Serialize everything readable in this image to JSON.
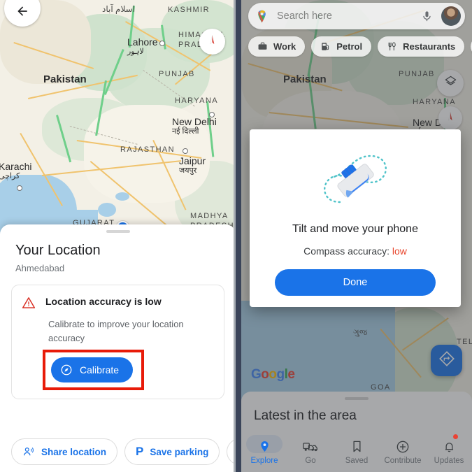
{
  "left_panel": {
    "back_icon": "arrow-back-icon",
    "compass_icon": "compass-icon",
    "map": {
      "country_labels": [
        "Pakistan"
      ],
      "region_labels": [
        "KASHMIR",
        "HIMACHAL PRADESH",
        "PUNJAB",
        "HARYANA",
        "RAJASTHAN",
        "GUJARAT",
        "MADHYA PRADESH"
      ],
      "cities": [
        {
          "name": "Lahore",
          "native": "لاہور"
        },
        {
          "name": "New Delhi",
          "native": "नई दिल्ली"
        },
        {
          "name": "Jaipur",
          "native": "जयपुर"
        },
        {
          "name": "Karachi",
          "native": "کراچی"
        },
        {
          "name": "اسلام آباد",
          "native": ""
        }
      ]
    },
    "sheet": {
      "title": "Your Location",
      "subtitle": "Ahmedabad",
      "accuracy_card": {
        "warning_icon": "warning-triangle-icon",
        "heading": "Location accuracy is low",
        "body": "Calibrate to improve your location accuracy",
        "calibrate_button": {
          "label": "Calibrate",
          "icon": "compass-circle-icon",
          "highlighted": true,
          "highlight_color": "#e81b09",
          "background": "#1a73e8"
        }
      },
      "chips": [
        {
          "label": "Share location",
          "icon": "share-person-icon"
        },
        {
          "label": "Save parking",
          "icon": "parking-p-icon"
        },
        {
          "label": "",
          "icon": "feedback-message-icon"
        }
      ]
    }
  },
  "right_panel": {
    "search": {
      "placeholder": "Search here",
      "logo_icon": "google-maps-pin-icon",
      "mic_icon": "microphone-icon",
      "avatar_icon": "account-avatar"
    },
    "category_chips": [
      {
        "label": "Work",
        "icon": "briefcase-icon"
      },
      {
        "label": "Petrol",
        "icon": "fuel-pump-icon"
      },
      {
        "label": "Restaurants",
        "icon": "cutlery-icon"
      },
      {
        "label": "",
        "icon": "hotel-bed-icon"
      }
    ],
    "map": {
      "country_labels": [
        "Pakistan"
      ],
      "region_labels": [
        "PUNJAB",
        "HARYANA",
        "GOA",
        "TEL"
      ],
      "cities": [
        {
          "name": "New D",
          "native": ""
        }
      ],
      "layers_icon": "map-layers-icon",
      "compass_icon": "compass-icon",
      "navigate_icon": "navigation-arrow-icon",
      "brand": {
        "g1": "G",
        "o1": "o",
        "o2": "o",
        "g2": "g",
        "l": "l",
        "e": "e"
      }
    },
    "dialog": {
      "illustration_icon": "tilt-phone-figure-eight-icon",
      "title": "Tilt and move your phone",
      "accuracy_label": "Compass accuracy:",
      "accuracy_value": "low",
      "accuracy_value_color": "#e8452c",
      "done_button": "Done"
    },
    "bottom_sheet": {
      "title": "Latest in the area"
    },
    "nav_items": [
      {
        "label": "Explore",
        "icon": "location-pin-icon",
        "active": true,
        "badge": false
      },
      {
        "label": "Go",
        "icon": "commute-car-icon",
        "active": false,
        "badge": false
      },
      {
        "label": "Saved",
        "icon": "bookmark-icon",
        "active": false,
        "badge": false
      },
      {
        "label": "Contribute",
        "icon": "plus-circle-icon",
        "active": false,
        "badge": false
      },
      {
        "label": "Updates",
        "icon": "bell-icon",
        "active": false,
        "badge": true
      }
    ]
  },
  "colors": {
    "accent_blue": "#1a73e8",
    "alert_red": "#e8452c",
    "highlight_red": "#e81b09"
  }
}
